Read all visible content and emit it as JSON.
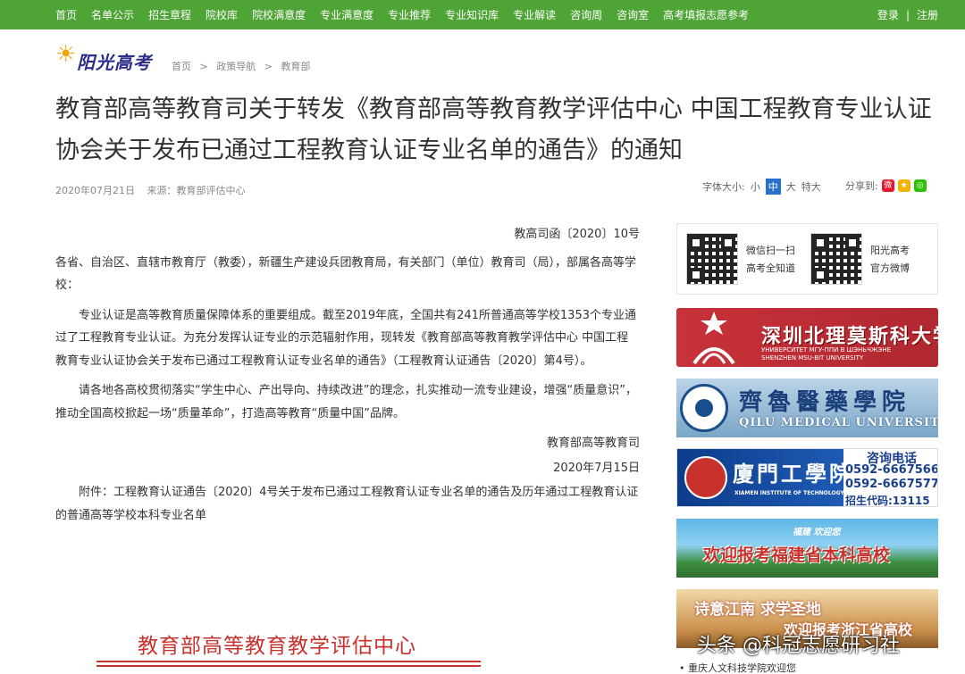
{
  "nav": {
    "items": [
      "首页",
      "名单公示",
      "招生章程",
      "院校库",
      "院校满意度",
      "专业满意度",
      "专业推荐",
      "专业知识库",
      "专业解读",
      "咨询周",
      "咨询室",
      "高考填报志愿参考"
    ],
    "login": "登录",
    "sep": "|",
    "register": "注册"
  },
  "logo": {
    "text": "阳光高考"
  },
  "breadcrumb": [
    "首页",
    ">",
    "政策导航",
    ">",
    "教育部"
  ],
  "article": {
    "title": "教育部高等教育司关于转发《教育部高等教育教学评估中心 中国工程教育专业认证协会关于发布已通过工程教育认证专业名单的通告》的通知",
    "date": "2020年07月21日",
    "source": "来源：教育部评估中心",
    "font_size_label": "字体大小:",
    "font_sizes": [
      "小",
      "中",
      "大",
      "特大"
    ],
    "share_label": "分享到:",
    "doc_number": "教高司函〔2020〕10号",
    "recipients": "各省、自治区、直辖市教育厅（教委），新疆生产建设兵团教育局，有关部门（单位）教育司（局），部属各高等学校：",
    "para1": "专业认证是高等教育质量保障体系的重要组成。截至2019年底，全国共有241所普通高等学校1353个专业通过了工程教育专业认证。为充分发挥认证专业的示范辐射作用，现转发《教育部高等教育教学评估中心 中国工程教育专业认证协会关于发布已通过工程教育认证专业名单的通告》（工程教育认证通告〔2020〕第4号）。",
    "para2": "请各地各高校贯彻落实“学生中心、产出导向、持续改进”的理念，扎实推动一流专业建设，增强“质量意识”，推动全国高校掀起一场“质量革命”，打造高等教育“质量中国”品牌。",
    "signature": "教育部高等教育司",
    "sign_date": "2020年7月15日",
    "attachment": "附件：工程教育认证通告〔2020〕4号关于发布已通过工程教育认证专业名单的通告及历年通过工程教育认证的普通高等学校本科专业名单",
    "banner_title": "教育部高等教育教学评估中心"
  },
  "sidebar": {
    "qr1_line1": "微信扫一扫",
    "qr1_line2": "高考全知道",
    "qr2_line1": "阳光高考",
    "qr2_line2": "官方微博",
    "ads": {
      "szbl_cn": "深圳北理莫斯科大学",
      "szbl_ru": "УНИВЕРСИТЕТ МГУ-ППИ В ШЭНЬЧЖЭНЕ",
      "szbl_en": "SHENZHEN MSU-BIT UNIVERSITY",
      "qilu_cn": "齊魯醫藥學院",
      "qilu_en": "QILU MEDICAL UNIVERSITY",
      "xmit_cn": "廈門工學院",
      "xmit_en": "XIAMEN INSTITUTE OF TECHNOLOGY",
      "xmit_phone_label": "咨询电话",
      "xmit_phone1": "0592-6667566",
      "xmit_phone2": "0592-6667577",
      "xmit_code": "招生代码:13115",
      "fujian_small": "福建 欢迎您",
      "fujian_main": "欢迎报考福建省本科高校",
      "zj_line1": "诗意江南 求学圣地",
      "zj_line2": "欢迎报考浙江省高校"
    },
    "bottom_link": "• 重庆人文科技学院欢迎您"
  },
  "watermark": "头条 @科冠志愿研习社",
  "colors": {
    "nav_bg": "#4ea435",
    "accent_red": "#c8322d",
    "link_blue": "#2a6fc9"
  }
}
